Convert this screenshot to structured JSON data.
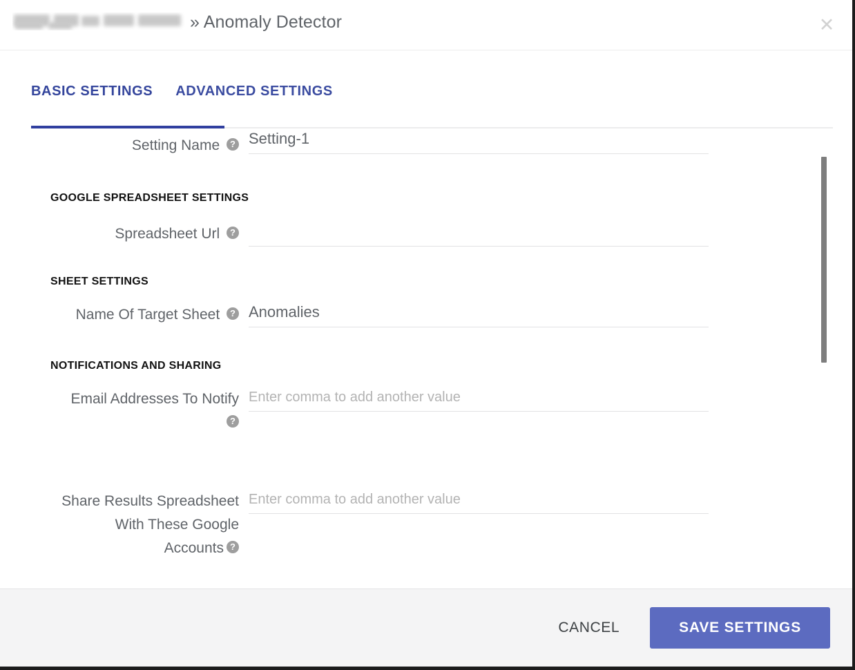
{
  "header": {
    "title_redacted": "",
    "title_separator": "»",
    "title_text": "Anomaly Detector",
    "title_suffix": "» Anomaly Detector",
    "close_icon": "close-icon"
  },
  "tabs": [
    {
      "label": "BASIC SETTINGS",
      "active": true
    },
    {
      "label": "ADVANCED SETTINGS",
      "active": false
    }
  ],
  "form": {
    "setting_name": {
      "label": "Setting Name",
      "help": "?",
      "value": "Setting-1",
      "placeholder": ""
    },
    "section_spreadsheet": "GOOGLE SPREADSHEET SETTINGS",
    "spreadsheet_url": {
      "label": "Spreadsheet Url",
      "help": "?",
      "value": "",
      "placeholder": ""
    },
    "section_sheet": "SHEET SETTINGS",
    "target_sheet": {
      "label": "Name Of Target Sheet",
      "help": "?",
      "value": "Anomalies",
      "placeholder": ""
    },
    "section_notifications": "NOTIFICATIONS AND SHARING",
    "emails_to_notify": {
      "label": "Email Addresses To Notify",
      "help": "?",
      "value": "",
      "placeholder": "Enter comma to add another value"
    },
    "share_accounts": {
      "label_line1": "Share Results Spreadsheet",
      "label_line2": "With These Google",
      "label_line3": "Accounts",
      "help": "?",
      "value": "",
      "placeholder": "Enter comma to add another value"
    }
  },
  "footer": {
    "cancel_label": "CANCEL",
    "save_label": "SAVE SETTINGS"
  },
  "colors": {
    "accent": "#5c6bc0",
    "tab_active": "#303f9f",
    "tab_text": "#3a4ba0",
    "label_text": "#5f6368",
    "footer_bg": "#f4f4f5",
    "placeholder": "#b3b3b3",
    "scrollbar_thumb": "#7e7e7e"
  }
}
